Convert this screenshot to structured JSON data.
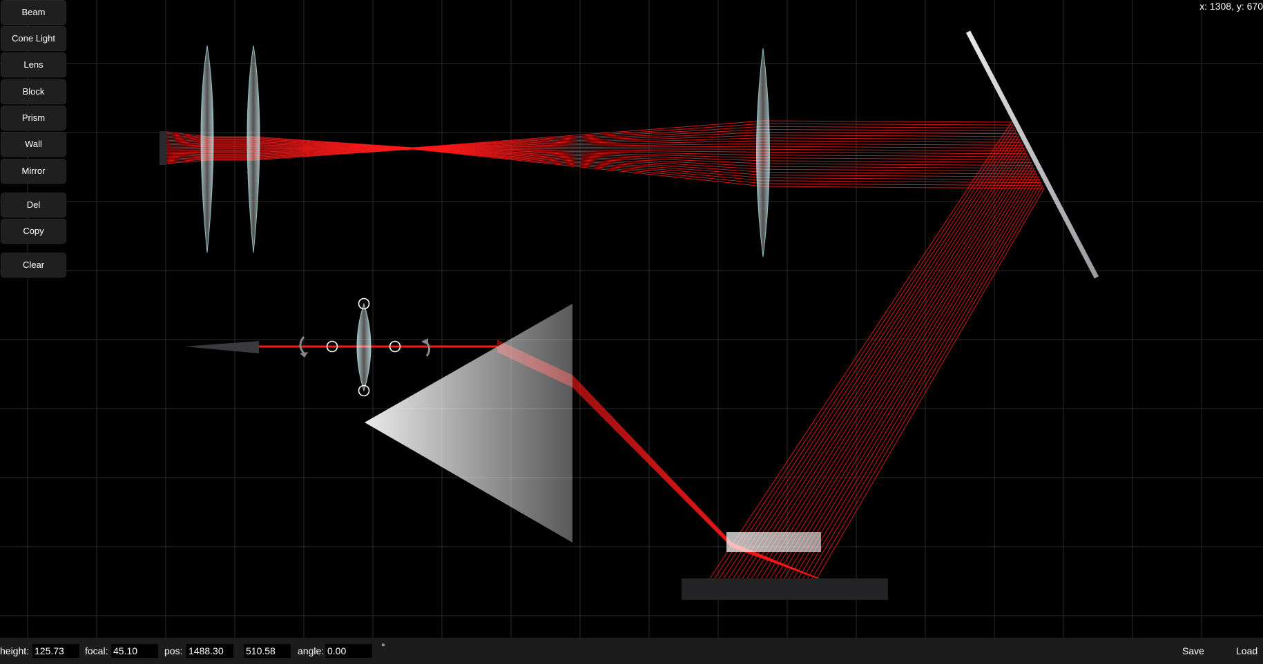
{
  "toolbar": {
    "beam": "Beam",
    "cone_light": "Cone Light",
    "lens": "Lens",
    "block": "Block",
    "prism": "Prism",
    "wall": "Wall",
    "mirror": "Mirror",
    "del": "Del",
    "copy": "Copy",
    "clear": "Clear"
  },
  "cursor_readout": "x: 1308, y: 670",
  "properties": {
    "height_label": "height:",
    "height_value": "125.73",
    "focal_label": "focal:",
    "focal_value": "45.10",
    "pos_label": "pos:",
    "pos_x": "1488.30",
    "pos_y": "510.58",
    "angle_label": "angle:",
    "angle_value": "0.00",
    "degree_symbol": "°"
  },
  "file": {
    "save": "Save",
    "load": "Load"
  },
  "colors": {
    "ray": "#ff1a1a",
    "background": "#000000",
    "grid": "#2c2c2c",
    "panel": "#1c1c1c",
    "lens": "#a9dbe0"
  },
  "icons": {
    "rotate_left": "rotate-ccw-icon",
    "rotate_right": "rotate-cw-icon",
    "handle": "circle-handle-icon"
  }
}
